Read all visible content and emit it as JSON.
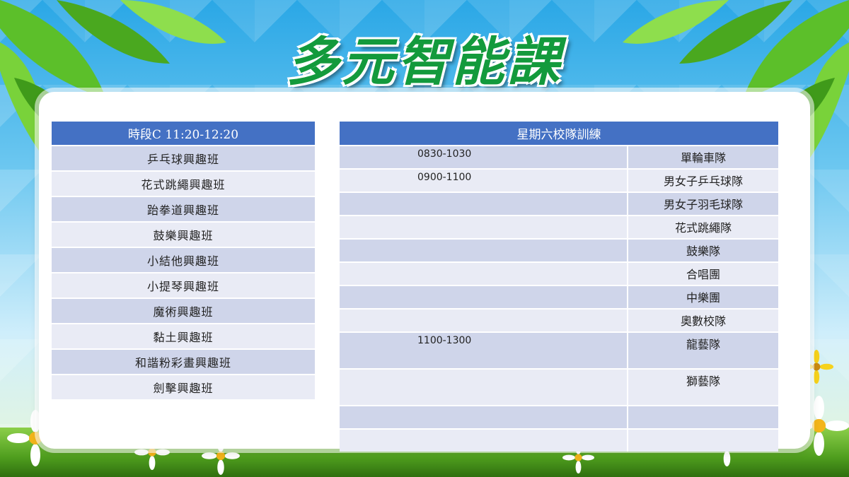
{
  "title": "多元智能課",
  "left_table": {
    "header": "時段C 11:20-12:20",
    "rows": [
      "乒乓球興趣班",
      "花式跳繩興趣班",
      "跆拳道興趣班",
      "鼓樂興趣班",
      "小結他興趣班",
      "小提琴興趣班",
      "魔術興趣班",
      "黏土興趣班",
      "和諧粉彩畫興趣班",
      "劍擊興趣班"
    ]
  },
  "right_table": {
    "header": "星期六校隊訓練",
    "rows": [
      {
        "time": "0830-1030",
        "team": "單輪車隊"
      },
      {
        "time": "0900-1100",
        "team": "男女子乒乓球隊"
      },
      {
        "time": "",
        "team": "男女子羽毛球隊"
      },
      {
        "time": "",
        "team": "花式跳繩隊"
      },
      {
        "time": "",
        "team": "鼓樂隊"
      },
      {
        "time": "",
        "team": "合唱團"
      },
      {
        "time": "",
        "team": "中樂團"
      },
      {
        "time": "",
        "team": "奧數校隊"
      },
      {
        "time": "1100-1300",
        "team": "龍藝隊"
      },
      {
        "time": "",
        "team": "獅藝隊"
      },
      {
        "time": "",
        "team": ""
      },
      {
        "time": "",
        "team": ""
      }
    ]
  },
  "colors": {
    "header_bg": "#4471c4",
    "row_dark": "#cfd5ea",
    "row_light": "#e9ebf5",
    "title": "#139a3c"
  }
}
